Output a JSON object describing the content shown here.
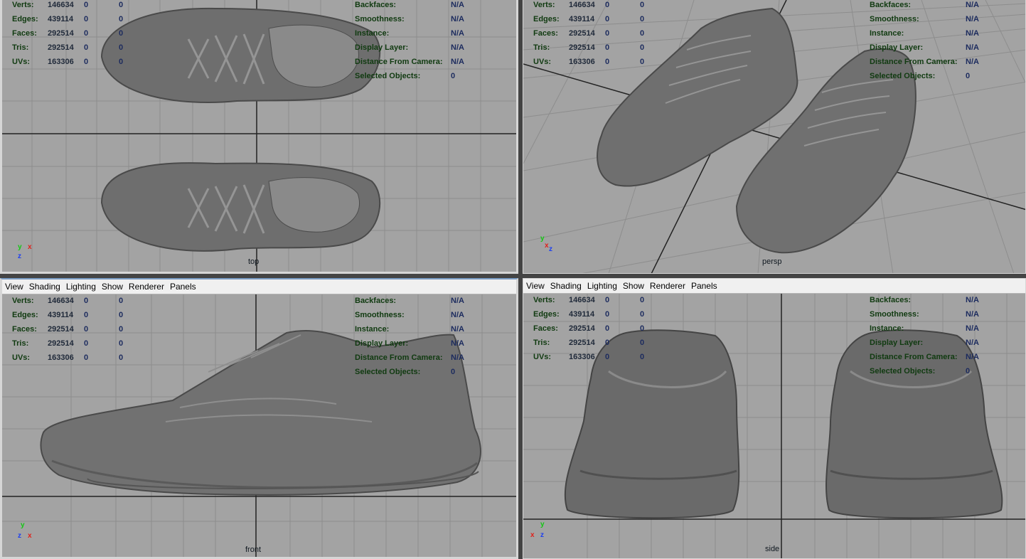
{
  "hud_left": {
    "labels": [
      "Verts:",
      "Edges:",
      "Faces:",
      "Tris:",
      "UVs:"
    ],
    "values": [
      "146634",
      "439114",
      "292514",
      "292514",
      "163306"
    ],
    "zero": "0"
  },
  "hud_right": {
    "labels": [
      "Backfaces:",
      "Smoothness:",
      "Instance:",
      "Display Layer:",
      "Distance From Camera:",
      "Selected Objects:"
    ],
    "values": [
      "N/A",
      "N/A",
      "N/A",
      "N/A",
      "N/A",
      "0"
    ]
  },
  "menu": [
    "View",
    "Shading",
    "Lighting",
    "Show",
    "Renderer",
    "Panels"
  ],
  "viewports": {
    "top": "top",
    "persp": "persp",
    "front": "front",
    "side": "side"
  },
  "axes": {
    "x": "x",
    "y": "y",
    "z": "z"
  },
  "colors": {
    "viewport_bg": "#a3a3a3",
    "grid": "#8c8c8c",
    "shoe": "#6e6e6e",
    "axis_x": "#e0211b",
    "axis_y": "#12c912",
    "axis_z": "#1c3ff0"
  }
}
